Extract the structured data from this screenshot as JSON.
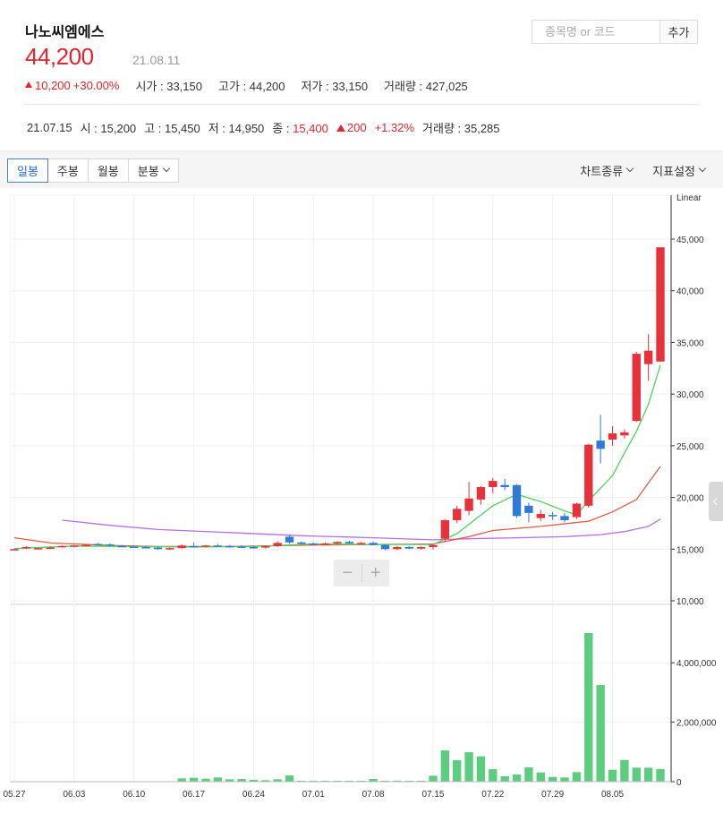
{
  "stock": {
    "name": "나노씨엠에스",
    "price": "44,200",
    "date": "21.08.11",
    "change": "10,200",
    "change_rate": "+30.00%",
    "open_label": "시가",
    "open": "33,150",
    "high_label": "고가",
    "high": "44,200",
    "low_label": "저가",
    "low": "33,150",
    "volume_label": "거래량",
    "volume": "427,025"
  },
  "search": {
    "placeholder": "종목명 or 코드",
    "add_label": "추가"
  },
  "prev_day": {
    "date": "21.07.15",
    "open": "시 : 15,200",
    "high": "고 : 15,450",
    "low": "저 : 14,950",
    "close_label": "종 :",
    "close": "15,400",
    "change": "200",
    "rate": "+1.32%",
    "volume": "거래량 : 35,285"
  },
  "toolbar": {
    "tabs": [
      {
        "label": "일봉",
        "active": true
      },
      {
        "label": "주봉"
      },
      {
        "label": "월봉"
      },
      {
        "label": "분봉"
      }
    ],
    "chart_type_label": "차트종류",
    "indicator_label": "지표설정"
  },
  "colors": {
    "up": "#e8313a",
    "down": "#2f7ad6",
    "volume": "#5ccd7f",
    "ma5": "#4cd35a",
    "ma20": "#e05a47",
    "ma60": "#b46ee8",
    "grid": "#efefef"
  },
  "chart_data": {
    "type": "candlestick",
    "scale_label": "Linear",
    "price_range": [
      10000,
      45000
    ],
    "price_ticks": [
      "10,000",
      "15,000",
      "20,000",
      "25,000",
      "30,000",
      "35,000",
      "40,000",
      "45,000"
    ],
    "volume_range": [
      0,
      5000000
    ],
    "volume_ticks": [
      "0",
      "2,000,000",
      "4,000,000"
    ],
    "x_labels": [
      {
        "label": "05.27",
        "index": 0
      },
      {
        "label": "06.03",
        "index": 5
      },
      {
        "label": "06.10",
        "index": 10
      },
      {
        "label": "06.17",
        "index": 15
      },
      {
        "label": "06.24",
        "index": 20
      },
      {
        "label": "07.01",
        "index": 25
      },
      {
        "label": "07.08",
        "index": 30
      },
      {
        "label": "07.15",
        "index": 35
      },
      {
        "label": "07.22",
        "index": 40
      },
      {
        "label": "07.29",
        "index": 45
      },
      {
        "label": "08.05",
        "index": 50
      }
    ],
    "candles": [
      [
        15000,
        15050,
        14900,
        15000
      ],
      [
        15100,
        15300,
        15000,
        15200
      ],
      [
        15050,
        15150,
        14950,
        15100
      ],
      [
        15100,
        15250,
        15000,
        15150
      ],
      [
        15200,
        15350,
        15150,
        15300
      ],
      [
        15300,
        15400,
        15200,
        15350
      ],
      [
        15350,
        15500,
        15250,
        15400
      ],
      [
        15500,
        15600,
        15400,
        15450
      ],
      [
        15450,
        15550,
        15300,
        15350
      ],
      [
        15300,
        15400,
        15200,
        15250
      ],
      [
        15250,
        15350,
        15150,
        15200
      ],
      [
        15200,
        15300,
        15100,
        15150
      ],
      [
        15150,
        15250,
        14950,
        15000
      ],
      [
        15000,
        15150,
        14900,
        15100
      ],
      [
        15100,
        15450,
        15050,
        15350
      ],
      [
        15300,
        15650,
        15200,
        15250
      ],
      [
        15250,
        15400,
        15150,
        15350
      ],
      [
        15350,
        15500,
        15250,
        15300
      ],
      [
        15300,
        15400,
        15150,
        15250
      ],
      [
        15250,
        15350,
        15100,
        15200
      ],
      [
        15200,
        15300,
        15050,
        15150
      ],
      [
        15150,
        15350,
        15050,
        15300
      ],
      [
        15300,
        15750,
        15200,
        15600
      ],
      [
        16200,
        16400,
        15550,
        15650
      ],
      [
        15650,
        15750,
        15450,
        15550
      ],
      [
        15550,
        15650,
        15400,
        15500
      ],
      [
        15500,
        15650,
        15400,
        15550
      ],
      [
        15550,
        15750,
        15450,
        15700
      ],
      [
        15700,
        15800,
        15500,
        15550
      ],
      [
        15550,
        15700,
        15450,
        15600
      ],
      [
        15600,
        15700,
        15350,
        15400
      ],
      [
        15400,
        15500,
        14900,
        15000
      ],
      [
        15000,
        15300,
        14900,
        15200
      ],
      [
        15200,
        15300,
        15000,
        15050
      ],
      [
        15050,
        15250,
        14950,
        15200
      ],
      [
        15200,
        15450,
        14950,
        15400
      ],
      [
        16000,
        17900,
        15700,
        17800
      ],
      [
        17800,
        19200,
        17500,
        18900
      ],
      [
        18700,
        21500,
        18300,
        19900
      ],
      [
        19800,
        21100,
        19300,
        21000
      ],
      [
        21000,
        21900,
        20400,
        21600
      ],
      [
        21200,
        21800,
        20700,
        21000
      ],
      [
        21200,
        21300,
        18000,
        18200
      ],
      [
        19200,
        19500,
        17600,
        18500
      ],
      [
        18000,
        18800,
        17700,
        18400
      ],
      [
        18300,
        18600,
        17800,
        18200
      ],
      [
        18200,
        18500,
        17600,
        17800
      ],
      [
        18100,
        19500,
        17900,
        19400
      ],
      [
        19200,
        25200,
        19000,
        25100
      ],
      [
        25500,
        28000,
        23300,
        24700
      ],
      [
        25600,
        26900,
        25000,
        26200
      ],
      [
        26000,
        26600,
        25700,
        26300
      ],
      [
        27400,
        34100,
        27300,
        33900
      ],
      [
        32900,
        35800,
        31300,
        34200
      ],
      [
        33150,
        44200,
        33150,
        44200
      ]
    ],
    "volumes": [
      5000,
      5000,
      5000,
      5000,
      5000,
      5000,
      5000,
      5000,
      5000,
      5000,
      5000,
      5000,
      5000,
      5000,
      110000,
      130000,
      100000,
      140000,
      80000,
      90000,
      60000,
      50000,
      80000,
      210000,
      30000,
      30000,
      30000,
      30000,
      30000,
      30000,
      90000,
      30000,
      35285,
      30000,
      30000,
      200000,
      1050000,
      720000,
      990000,
      850000,
      420000,
      180000,
      240000,
      480000,
      310000,
      160000,
      140000,
      320000,
      5000000,
      3250000,
      400000,
      730000,
      470000,
      470000,
      427025
    ],
    "ma5": [
      [
        0,
        15050
      ],
      [
        5,
        15300
      ],
      [
        10,
        15250
      ],
      [
        15,
        15200
      ],
      [
        20,
        15250
      ],
      [
        25,
        15500
      ],
      [
        30,
        15450
      ],
      [
        35,
        15450
      ],
      [
        37,
        16500
      ],
      [
        40,
        19200
      ],
      [
        42,
        20300
      ],
      [
        44,
        19600
      ],
      [
        46,
        18700
      ],
      [
        47,
        18300
      ],
      [
        48,
        19700
      ],
      [
        50,
        22100
      ],
      [
        51,
        24300
      ],
      [
        52,
        26400
      ],
      [
        53,
        29000
      ],
      [
        54,
        32800
      ]
    ],
    "ma20": [
      [
        0,
        16100
      ],
      [
        3,
        15600
      ],
      [
        5,
        15500
      ],
      [
        8,
        15350
      ],
      [
        12,
        15250
      ],
      [
        18,
        15250
      ],
      [
        25,
        15400
      ],
      [
        30,
        15450
      ],
      [
        35,
        15500
      ],
      [
        38,
        16200
      ],
      [
        40,
        16800
      ],
      [
        44,
        17200
      ],
      [
        48,
        17700
      ],
      [
        50,
        18600
      ],
      [
        51,
        19200
      ],
      [
        52,
        19800
      ],
      [
        53,
        21400
      ],
      [
        54,
        23000
      ]
    ],
    "ma60": [
      [
        4,
        17800
      ],
      [
        8,
        17300
      ],
      [
        12,
        16900
      ],
      [
        18,
        16600
      ],
      [
        24,
        16300
      ],
      [
        30,
        16100
      ],
      [
        35,
        15900
      ],
      [
        38,
        16000
      ],
      [
        42,
        16100
      ],
      [
        46,
        16200
      ],
      [
        49,
        16400
      ],
      [
        51,
        16700
      ],
      [
        53,
        17200
      ],
      [
        54,
        17900
      ]
    ]
  }
}
